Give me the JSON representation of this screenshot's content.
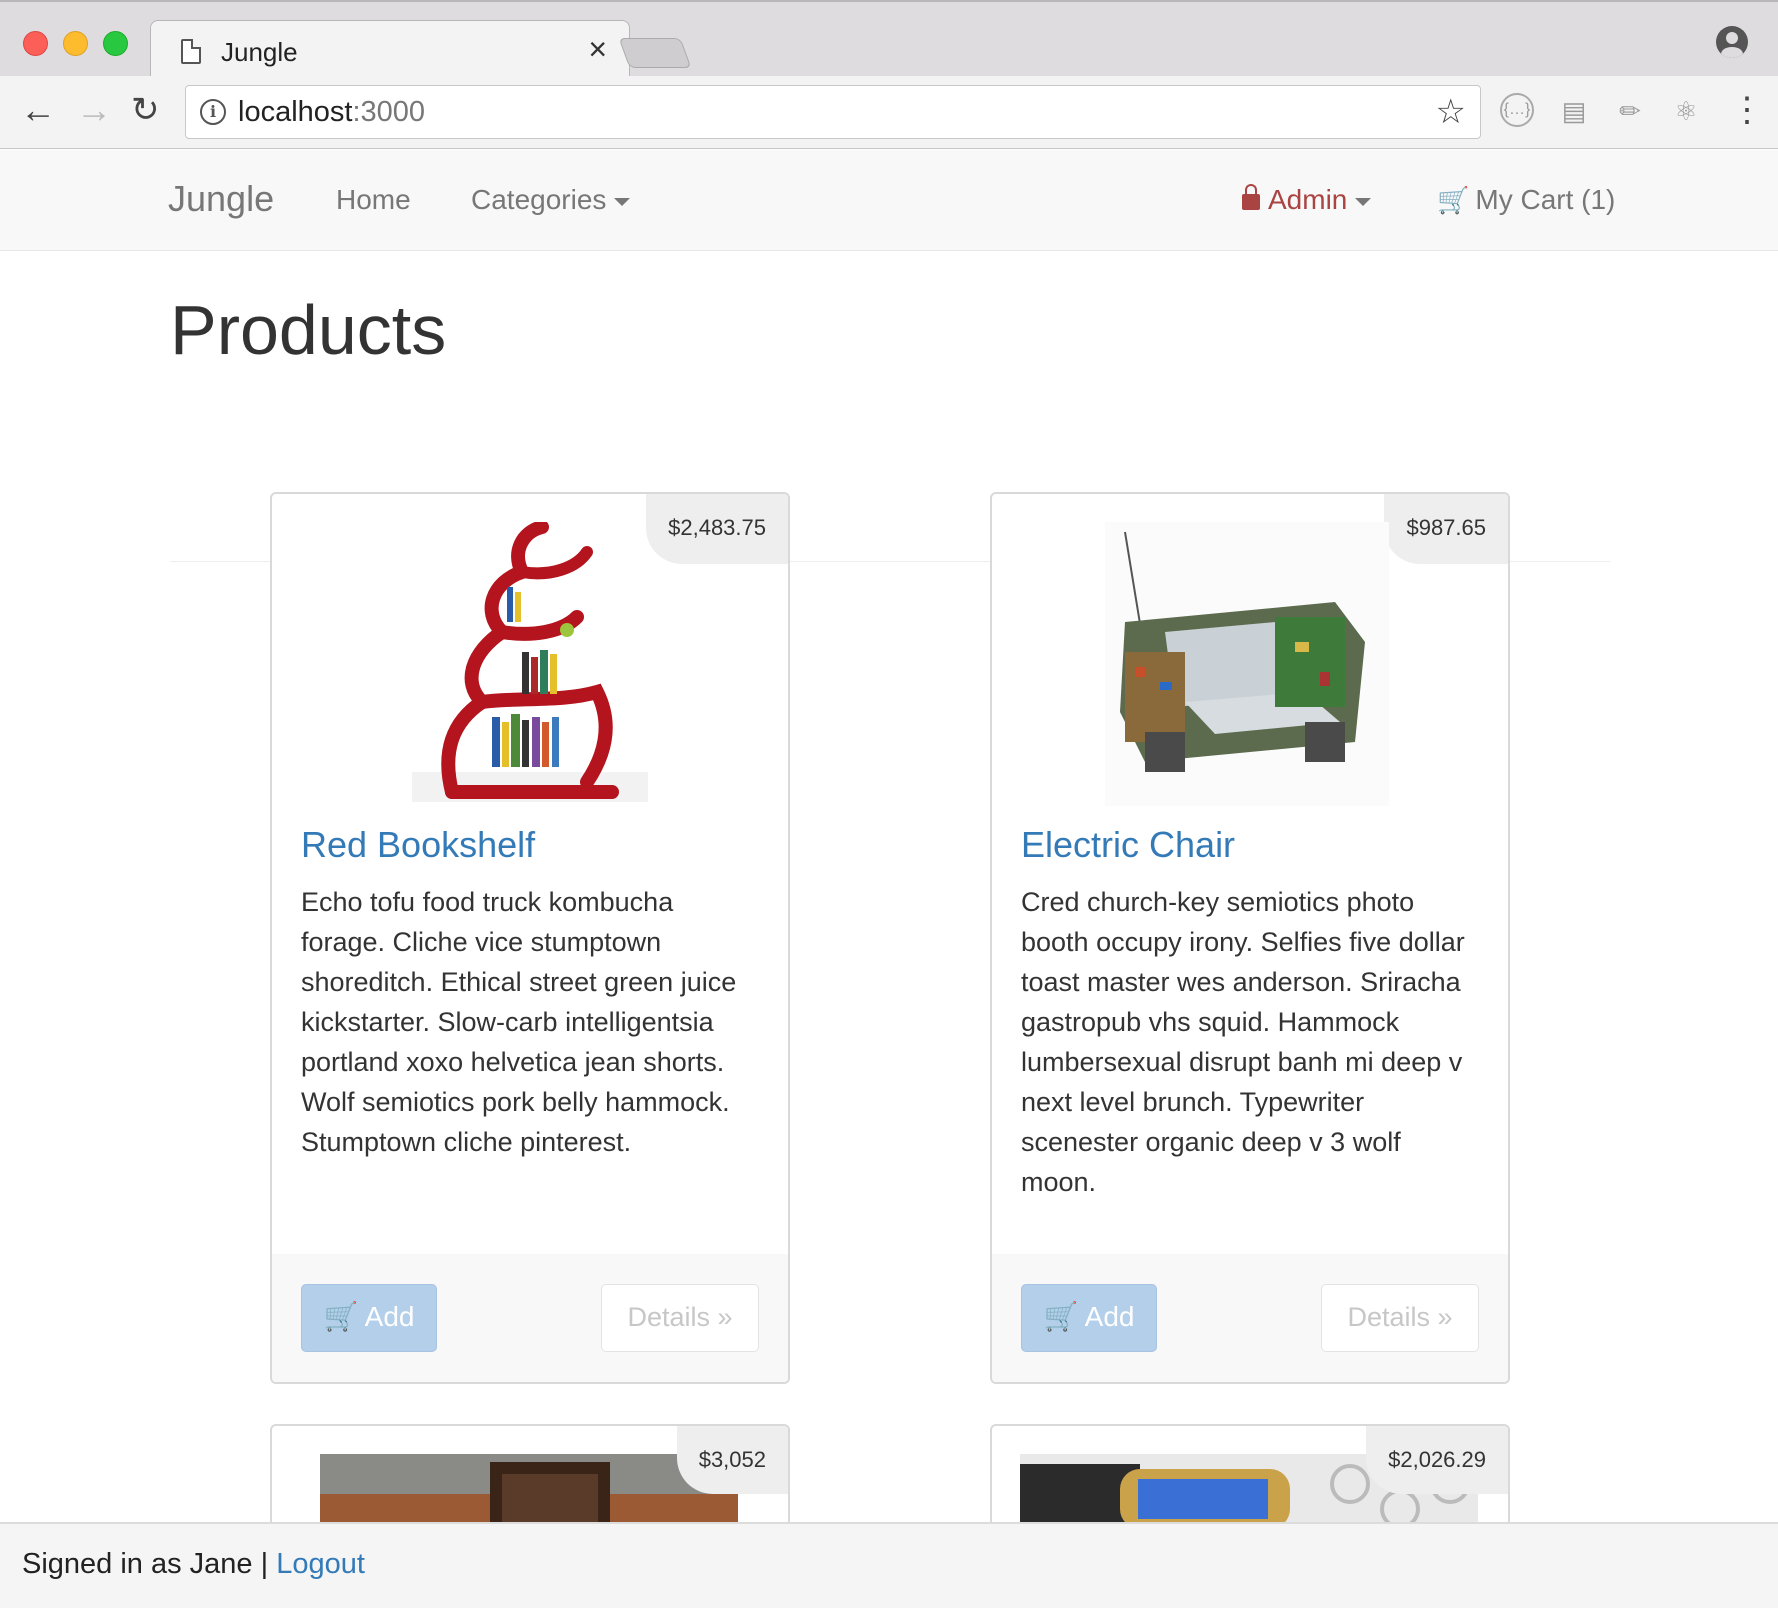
{
  "browser": {
    "tab_title": "Jungle",
    "tab_close": "×",
    "url_host": "localhost",
    "url_port": ":3000"
  },
  "navbar": {
    "brand": "Jungle",
    "home": "Home",
    "categories": "Categories",
    "admin": "Admin",
    "cart": "My Cart (1)"
  },
  "page": {
    "title": "Products"
  },
  "products": [
    {
      "name": "Red Bookshelf",
      "price": "$2,483.75",
      "description": "Echo tofu food truck kombucha forage. Cliche vice stumptown shoreditch. Ethical street green juice kickstarter. Slow-carb intelligentsia portland xoxo helvetica jean shorts. Wolf semiotics pork belly hammock. Stumptown cliche pinterest.",
      "add_label": "Add",
      "details_label": "Details »"
    },
    {
      "name": "Electric Chair",
      "price": "$987.65",
      "description": "Cred church-key semiotics photo booth occupy irony. Selfies five dollar toast master wes anderson. Sriracha gastropub vhs squid. Hammock lumbersexual disrupt banh mi deep v next level brunch. Typewriter scenester organic deep v 3 wolf moon.",
      "add_label": "Add",
      "details_label": "Details »"
    },
    {
      "price": "$3,052"
    },
    {
      "price": "$2,026.29"
    }
  ],
  "footer": {
    "signed_in": "Signed in as Jane |",
    "logout": "Logout"
  },
  "colors": {
    "link": "#337ab7",
    "admin": "#a94442",
    "add_button": "#b3cfe9"
  },
  "icons": [
    "page-icon",
    "close-icon",
    "profile-icon",
    "back-icon",
    "forward-icon",
    "reload-icon",
    "info-icon",
    "star-icon",
    "extension-icon",
    "menu-icon",
    "lock-icon",
    "cart-icon"
  ]
}
